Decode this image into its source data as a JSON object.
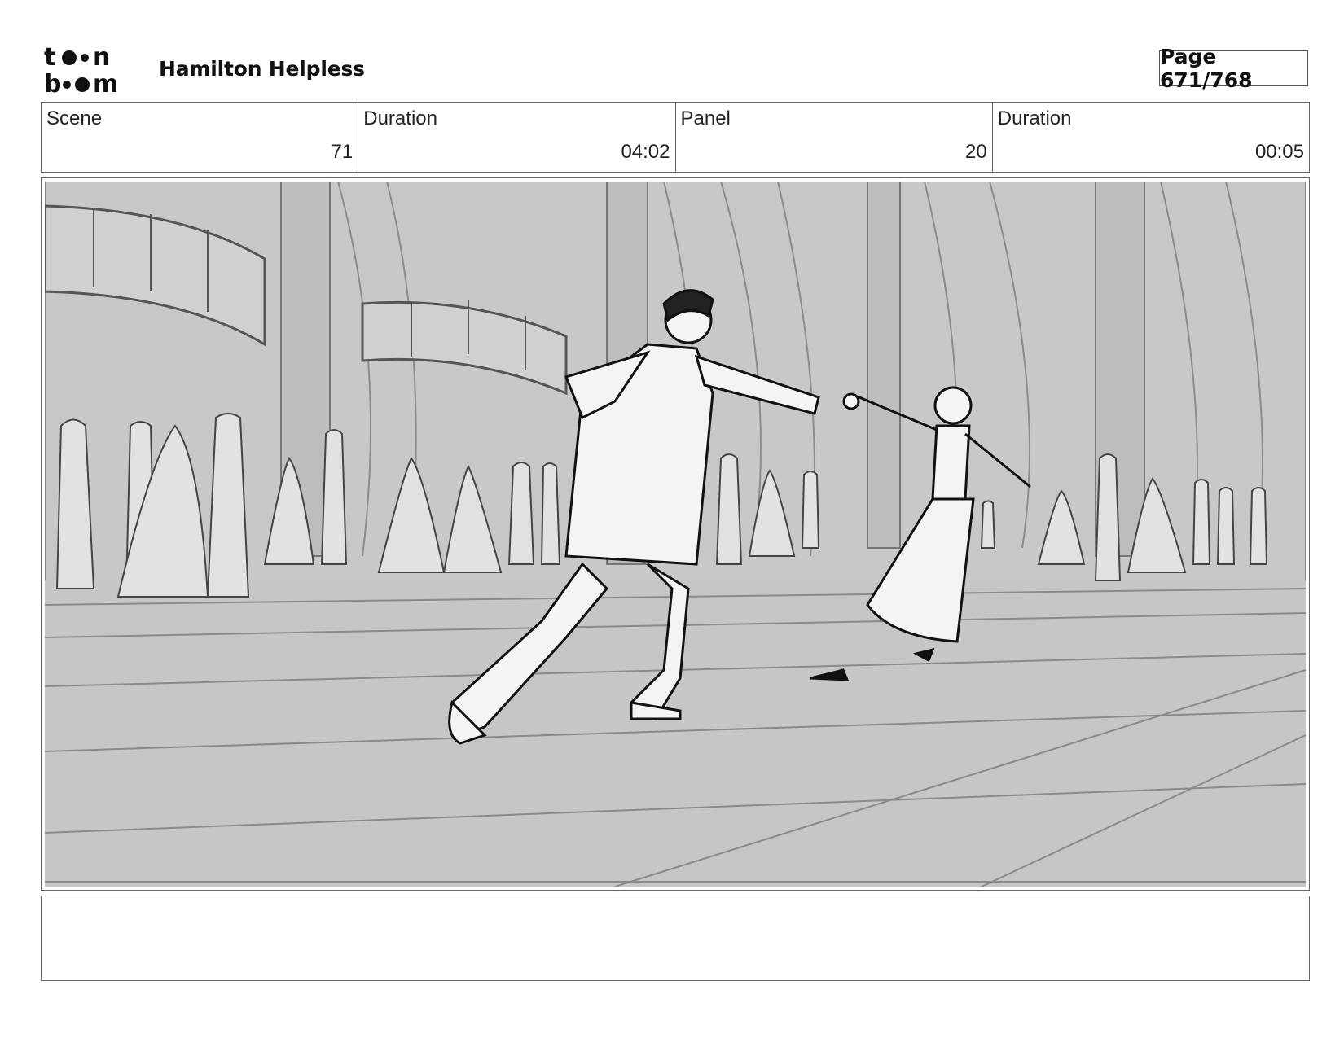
{
  "header": {
    "logo_line1": "t●●n",
    "logo_line2": "b●●m",
    "project_title": "Hamilton Helpless",
    "page_label": "Page 671/768"
  },
  "info": [
    {
      "label": "Scene",
      "value": "71"
    },
    {
      "label": "Duration",
      "value": "04:02"
    },
    {
      "label": "Panel",
      "value": "20"
    },
    {
      "label": "Duration",
      "value": "00:05"
    }
  ],
  "panel": {
    "image_description": "ballroom-dance-sketch"
  },
  "notes": {
    "text": ""
  },
  "colors": {
    "panel_background": "#c8c8c8",
    "sketch_line": "#222222",
    "border": "#666666"
  }
}
